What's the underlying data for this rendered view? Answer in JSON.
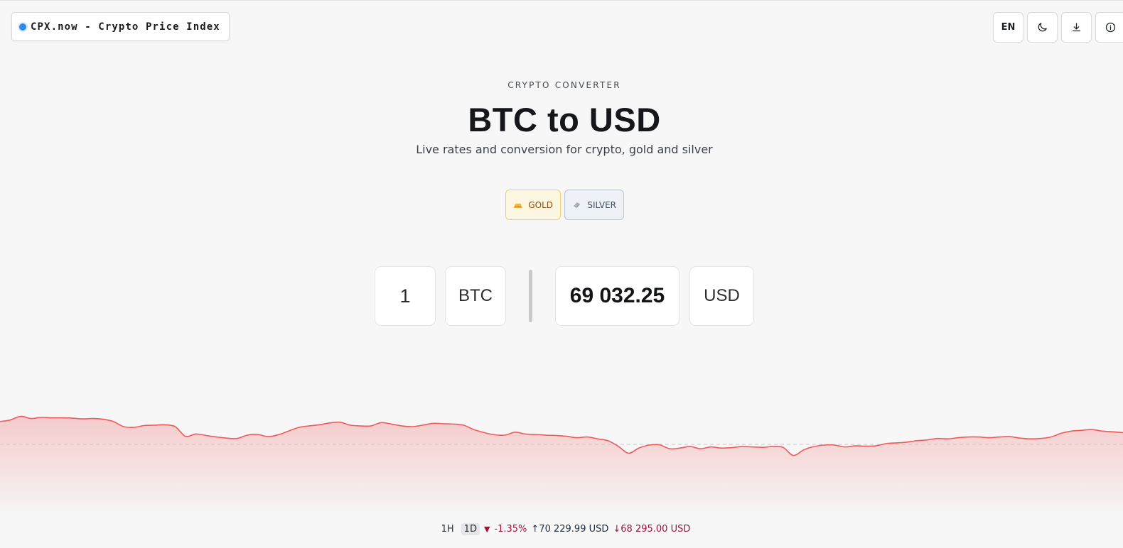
{
  "brand": {
    "label": "CPX.now - Crypto Price Index",
    "dot_color": "#2f8bf2"
  },
  "controls": {
    "language": "EN",
    "theme_icon": "moon-icon",
    "download_icon": "download-icon",
    "info_icon": "info-icon"
  },
  "hero": {
    "eyebrow": "CRYPTO CONVERTER",
    "title": "BTC to USD",
    "subtitle": "Live rates and conversion for crypto, gold and silver"
  },
  "metals": [
    {
      "label": "GOLD",
      "icon": "gold-bar-icon"
    },
    {
      "label": "SILVER",
      "icon": "silver-bar-icon"
    }
  ],
  "converter": {
    "amount": "1",
    "from_currency": "BTC",
    "result": "69 032.25",
    "to_currency": "USD"
  },
  "chart_data": {
    "type": "area",
    "trend_color": "#f05a5a",
    "baseline": "reference line at open price",
    "values": [
      0.62,
      0.66,
      0.76,
      0.7,
      0.73,
      0.72,
      0.72,
      0.71,
      0.69,
      0.7,
      0.68,
      0.62,
      0.48,
      0.46,
      0.51,
      0.52,
      0.53,
      0.48,
      0.22,
      0.28,
      0.24,
      0.2,
      0.17,
      0.16,
      0.25,
      0.27,
      0.21,
      0.26,
      0.36,
      0.46,
      0.5,
      0.53,
      0.58,
      0.6,
      0.52,
      0.5,
      0.5,
      0.59,
      0.55,
      0.5,
      0.48,
      0.52,
      0.57,
      0.56,
      0.55,
      0.52,
      0.4,
      0.32,
      0.26,
      0.25,
      0.33,
      0.28,
      0.27,
      0.25,
      0.24,
      0.22,
      0.18,
      0.2,
      0.15,
      0.1,
      -0.05,
      -0.24,
      -0.1,
      -0.02,
      -0.01,
      -0.12,
      -0.1,
      -0.06,
      -0.12,
      -0.07,
      -0.1,
      -0.09,
      -0.06,
      -0.07,
      -0.08,
      -0.06,
      -0.08,
      -0.3,
      -0.15,
      -0.06,
      -0.02,
      -0.02,
      -0.07,
      -0.04,
      -0.05,
      -0.04,
      0.02,
      0.04,
      0.06,
      0.1,
      0.12,
      0.16,
      0.15,
      0.18,
      0.2,
      0.2,
      0.18,
      0.2,
      0.21,
      0.17,
      0.15,
      0.16,
      0.2,
      0.3,
      0.36,
      0.38,
      0.4,
      0.36,
      0.34,
      0.32
    ]
  },
  "stats": {
    "periods": [
      "1H",
      "1D"
    ],
    "active_period": "1D",
    "change": "-1.35%",
    "high": "↑70 229.99 USD",
    "low": "↓68 295.00 USD"
  }
}
